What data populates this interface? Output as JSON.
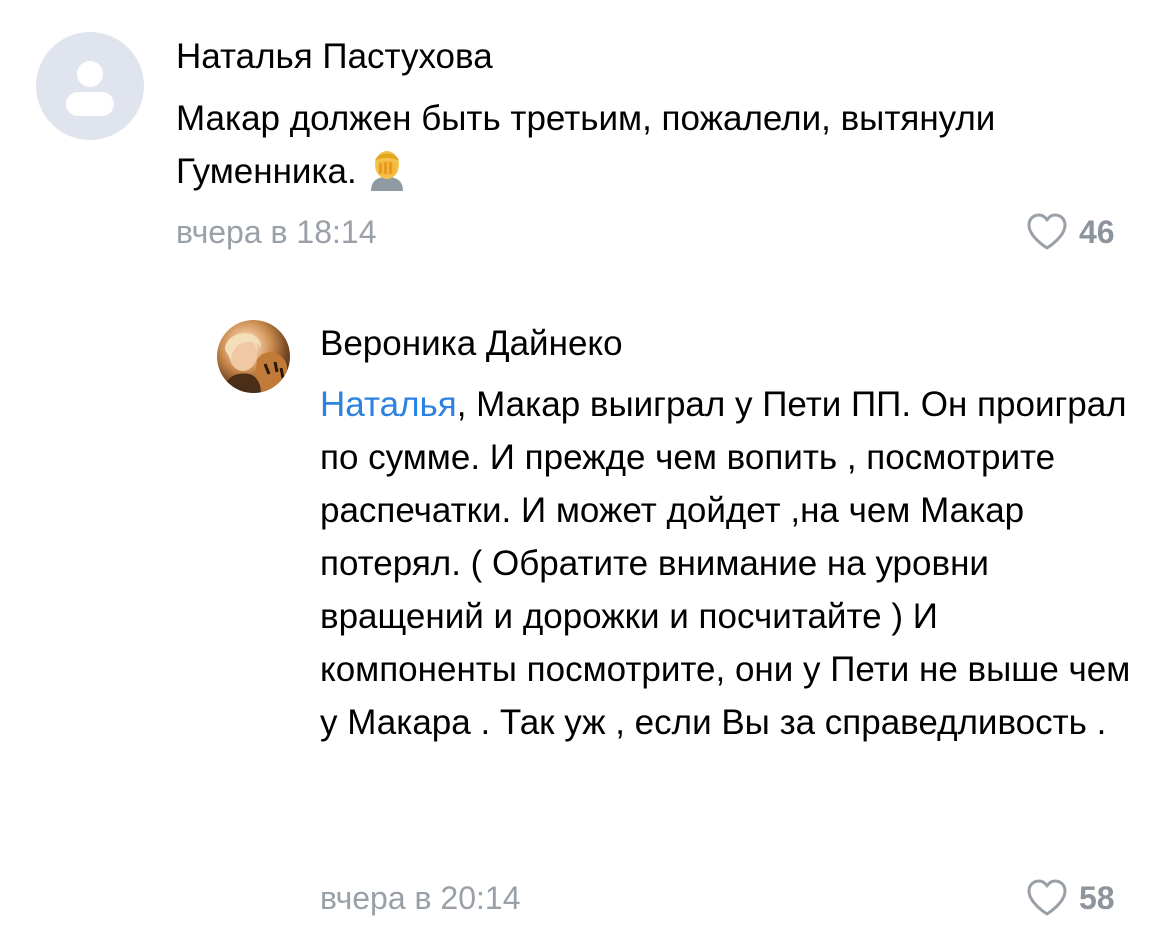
{
  "comments": [
    {
      "author": "Наталья Пастухова",
      "avatar": "default-user-icon",
      "text": "Макар должен быть третьим, пожалели, вытянули Гуменника.",
      "emoji": "facepalm-emoji",
      "time": "вчера в 18:14",
      "likes": "46"
    },
    {
      "author": "Вероника Дайнеко",
      "avatar": "user-photo",
      "mention": "Наталья",
      "text": ", Макар выиграл у Пети ПП. Он проиграл по сумме. И прежде чем вопить , посмотрите распечатки. И может дойдет ,на чем Макар потерял. ( Обратите внимание на уровни вращений и дорожки и посчитайте ) И компоненты посмотрите, они у Пети не выше чем у Макара . Так уж , если Вы за справедливость .",
      "time": "вчера в 20:14",
      "likes": "58"
    }
  ],
  "colors": {
    "mention": "#2d81e0",
    "meta": "#9aa0a7",
    "like_icon": "#9aa0a7",
    "avatar_placeholder": "#dfe4ee"
  }
}
